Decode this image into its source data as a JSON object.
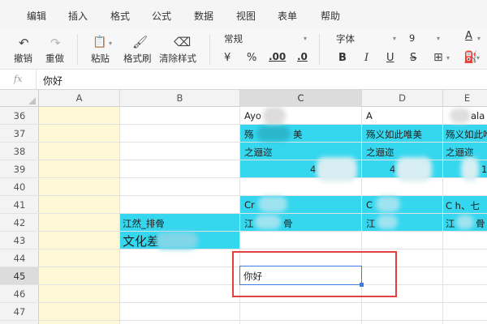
{
  "menu": [
    "编辑",
    "插入",
    "格式",
    "公式",
    "数据",
    "视图",
    "表单",
    "帮助"
  ],
  "toolbar": {
    "undo_label": "撤销",
    "redo_label": "重做",
    "paste_label": "粘贴",
    "format_painter_label": "格式刷",
    "clear_format_label": "清除样式",
    "number_format": "常规",
    "currency_symbol": "¥",
    "percent_symbol": "%",
    "decimal_increase": ".00",
    "decimal_decrease": ".0",
    "font_family": "字体",
    "font_size": "9",
    "bold": "B",
    "italic": "I",
    "underline": "U",
    "strikethrough": "S",
    "font_color": "A"
  },
  "formula_bar": {
    "fx_label": "fx",
    "value": "你好"
  },
  "columns": [
    "A",
    "B",
    "C",
    "D",
    "E"
  ],
  "active_column": "C",
  "rows": [
    "36",
    "37",
    "38",
    "39",
    "40",
    "41",
    "42",
    "43",
    "44",
    "45",
    "46",
    "47"
  ],
  "active_row": "45",
  "cells": {
    "C36": "Ayo",
    "D36": "A",
    "E36": "ala",
    "C37": "殇",
    "C37b": "美",
    "D37": "殇义如此唯美",
    "E37": "殇义如此唯",
    "C38": "之逦迩",
    "D38": "之逦迩",
    "E38": "之逦迩",
    "C39": "4",
    "D39": "4",
    "E39": "1",
    "C41": "Cr",
    "D41": "C",
    "E41": "C  h、七",
    "B42": "江然_排骨",
    "C42": "江",
    "C42b": "骨",
    "D42": "江",
    "E42": "江",
    "E42b": "骨",
    "B43": "文化差",
    "C45": "你好"
  },
  "colors": {
    "cyan_fill": "#35d7ef",
    "column_a_fill": "#fff8d6",
    "selection_border": "#3d7be6",
    "annotation_red": "#e34040"
  }
}
